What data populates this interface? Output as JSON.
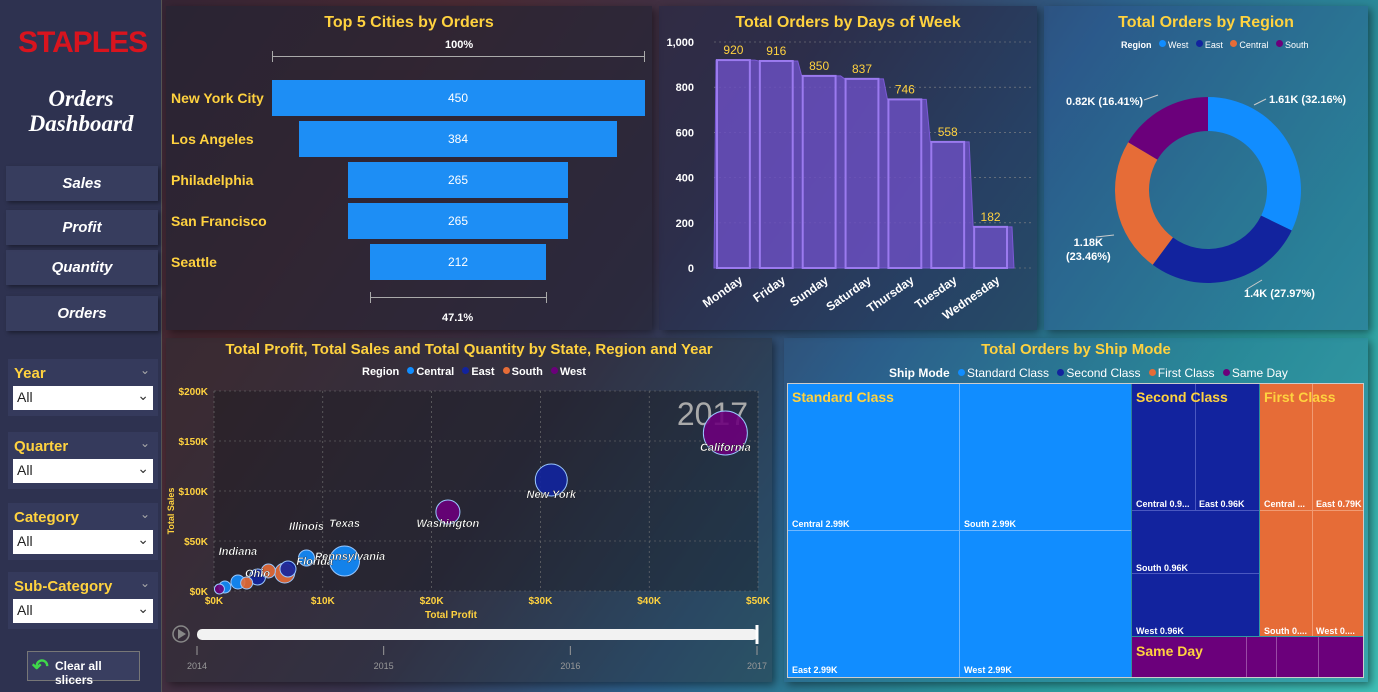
{
  "sidebar": {
    "logo": "STAPLES",
    "title_line1": "Orders",
    "title_line2": "Dashboard",
    "nav": [
      "Sales",
      "Profit",
      "Quantity",
      "Orders"
    ],
    "slicers": [
      {
        "label": "Year",
        "value": "All"
      },
      {
        "label": "Quarter",
        "value": "All"
      },
      {
        "label": "Category",
        "value": "All"
      },
      {
        "label": "Sub-Category",
        "value": "All"
      }
    ],
    "clear_label": "Clear all slicers"
  },
  "funnel": {
    "title": "Top 5 Cities by Orders",
    "top_pct": "100%",
    "bottom_pct": "47.1%",
    "chart_data": {
      "type": "bar",
      "categories": [
        "New York City",
        "Los Angeles",
        "Philadelphia",
        "San Francisco",
        "Seattle"
      ],
      "values": [
        450,
        384,
        265,
        265,
        212
      ]
    }
  },
  "days": {
    "title": "Total Orders by Days of Week",
    "chart_data": {
      "type": "area",
      "categories": [
        "Monday",
        "Friday",
        "Sunday",
        "Saturday",
        "Thursday",
        "Tuesday",
        "Wednesday"
      ],
      "values": [
        920,
        916,
        850,
        837,
        746,
        558,
        182
      ],
      "ylim": [
        0,
        1000
      ],
      "yticks": [
        "0",
        "200",
        "400",
        "600",
        "800",
        "1,000"
      ]
    }
  },
  "region": {
    "title": "Total Orders by Region",
    "legend_title": "Region",
    "chart_data": {
      "type": "pie",
      "slices": [
        {
          "name": "West",
          "value": 32.16,
          "label": "1.61K (32.16%)",
          "color": "#118dff"
        },
        {
          "name": "East",
          "value": 27.97,
          "label": "1.4K (27.97%)",
          "color": "#12239e"
        },
        {
          "name": "Central",
          "value": 23.46,
          "label": "1.18K (23.46%)",
          "color": "#e66c37"
        },
        {
          "name": "South",
          "value": 16.41,
          "label": "0.82K (16.41%)",
          "color": "#6b007b"
        }
      ]
    },
    "label_central_1": "1.18K",
    "label_central_2": "(23.46%)"
  },
  "scatter": {
    "title": "Total Profit, Total Sales and Total Quantity by State, Region and Year",
    "legend_title": "Region",
    "legend": [
      {
        "name": "Central",
        "color": "#118dff"
      },
      {
        "name": "East",
        "color": "#12239e"
      },
      {
        "name": "South",
        "color": "#e66c37"
      },
      {
        "name": "West",
        "color": "#6b007b"
      }
    ],
    "year": "2017",
    "xlabel": "Total Profit",
    "ylabel": "Total Sales",
    "xticks": [
      "$0K",
      "$10K",
      "$20K",
      "$30K",
      "$40K",
      "$50K"
    ],
    "yticks": [
      "$0K",
      "$50K",
      "$100K",
      "$150K",
      "$200K"
    ],
    "play_years": [
      "2014",
      "2015",
      "2016",
      "2017"
    ],
    "chart_data": {
      "type": "scatter",
      "xlim": [
        0,
        50
      ],
      "ylim": [
        0,
        200
      ],
      "points": [
        {
          "name": "California",
          "x": 47,
          "y": 158,
          "r": 22,
          "region": "West"
        },
        {
          "name": "New York",
          "x": 31,
          "y": 111,
          "r": 16,
          "region": "East"
        },
        {
          "name": "Washington",
          "x": 21.5,
          "y": 79,
          "r": 12,
          "region": "West"
        },
        {
          "name": "Texas",
          "x": 12,
          "y": 30,
          "r": 15,
          "region": "Central"
        },
        {
          "name": "Pennsylvania",
          "x": 12.5,
          "y": 28,
          "r": 0,
          "region": "East"
        },
        {
          "name": "Illinois",
          "x": 8.5,
          "y": 33,
          "r": 8,
          "region": "Central"
        },
        {
          "name": "Florida",
          "x": 6.5,
          "y": 18,
          "r": 10,
          "region": "South"
        },
        {
          "name": "Ohio",
          "x": 4,
          "y": 14,
          "r": 8,
          "region": "East"
        },
        {
          "name": "Indiana",
          "x": 2.2,
          "y": 9,
          "r": 7,
          "region": "Central"
        },
        {
          "name": "",
          "x": 6.8,
          "y": 22,
          "r": 8,
          "region": "East"
        },
        {
          "name": "",
          "x": 1,
          "y": 4,
          "r": 6,
          "region": "Central"
        },
        {
          "name": "",
          "x": 0.5,
          "y": 2,
          "r": 5,
          "region": "West"
        },
        {
          "name": "",
          "x": 3,
          "y": 8,
          "r": 6,
          "region": "South"
        },
        {
          "name": "",
          "x": 5,
          "y": 20,
          "r": 7,
          "region": "South"
        }
      ]
    }
  },
  "shipmode": {
    "title": "Total Orders by Ship Mode",
    "legend_title": "Ship Mode",
    "legend": [
      {
        "name": "Standard Class",
        "color": "#118dff"
      },
      {
        "name": "Second Class",
        "color": "#12239e"
      },
      {
        "name": "First Class",
        "color": "#e66c37"
      },
      {
        "name": "Same Day",
        "color": "#6b007b"
      }
    ],
    "headers": {
      "standard": "Standard Class",
      "second": "Second Class",
      "first": "First Class",
      "same": "Same Day"
    },
    "cells": {
      "std_central": "Central 2.99K",
      "std_south": "South 2.99K",
      "std_east": "East 2.99K",
      "std_west": "West 2.99K",
      "sec_central": "Central 0.9...",
      "sec_east": "East 0.96K",
      "sec_south": "South 0.96K",
      "sec_west": "West 0.96K",
      "fst_central": "Central ...",
      "fst_east": "East 0.79K",
      "fst_south": "South 0....",
      "fst_west": "West 0...."
    }
  }
}
